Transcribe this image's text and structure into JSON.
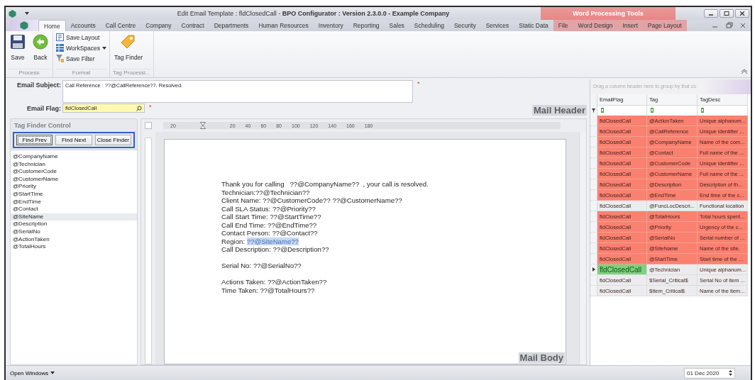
{
  "window": {
    "title": "Edit Email Template : fldClosedCall - **BPO Configurator : Version 2.3.0.0 - Example Company**",
    "context_group": "Word Processing Tools"
  },
  "tabs": [
    {
      "label": "Home",
      "selected": true,
      "context": false
    },
    {
      "label": "Accounts",
      "selected": false,
      "context": false
    },
    {
      "label": "Call Centre",
      "selected": false,
      "context": false
    },
    {
      "label": "Company",
      "selected": false,
      "context": false
    },
    {
      "label": "Contract",
      "selected": false,
      "context": false
    },
    {
      "label": "Departments",
      "selected": false,
      "context": false
    },
    {
      "label": "Human Resources",
      "selected": false,
      "context": false
    },
    {
      "label": "Inventory",
      "selected": false,
      "context": false
    },
    {
      "label": "Reporting",
      "selected": false,
      "context": false
    },
    {
      "label": "Sales",
      "selected": false,
      "context": false
    },
    {
      "label": "Scheduling",
      "selected": false,
      "context": false
    },
    {
      "label": "Security",
      "selected": false,
      "context": false
    },
    {
      "label": "Services",
      "selected": false,
      "context": false
    },
    {
      "label": "Static Data",
      "selected": false,
      "context": false
    },
    {
      "label": "File",
      "selected": false,
      "context": true
    },
    {
      "label": "Word Design",
      "selected": false,
      "context": true
    },
    {
      "label": "Insert",
      "selected": false,
      "context": true
    },
    {
      "label": "Page Layout",
      "selected": false,
      "context": true
    }
  ],
  "ribbon": {
    "groups": [
      {
        "label": "Process",
        "buttons": [
          {
            "label": "Save",
            "kind": "large"
          },
          {
            "label": "Back",
            "kind": "large"
          }
        ]
      },
      {
        "label": "Format",
        "buttons": [
          {
            "label": "Save Layout",
            "kind": "small",
            "dropdown": false
          },
          {
            "label": "WorkSpaces",
            "kind": "small",
            "dropdown": true
          },
          {
            "label": "Save Filter",
            "kind": "small",
            "dropdown": false
          }
        ]
      },
      {
        "label": "Tag Processi...",
        "buttons": [
          {
            "label": "Tag Finder",
            "kind": "large"
          }
        ]
      }
    ]
  },
  "email_subject": {
    "label": "Email Subject:",
    "value": "Call Reference : ??@CallReference??. Resolved.",
    "required_mark": "*"
  },
  "email_flag": {
    "label": "Email Flag:",
    "value": "fldClosedCall",
    "required_mark": "*"
  },
  "mail_header_label": "Mail Header",
  "mail_body_label": "Mail Body",
  "tag_finder": {
    "title": "Tag Finder Control",
    "buttons": [
      {
        "label": "Find Prev",
        "focused": true
      },
      {
        "label": "Find Next",
        "focused": false
      },
      {
        "label": "Close Finder",
        "focused": false
      }
    ],
    "tags": [
      {
        "label": "@CompanyName",
        "selected": false
      },
      {
        "label": "@Technician",
        "selected": false
      },
      {
        "label": "@CustomerCode",
        "selected": false
      },
      {
        "label": "@CustomerName",
        "selected": false
      },
      {
        "label": "@Priority",
        "selected": false
      },
      {
        "label": "@StartTime",
        "selected": false
      },
      {
        "label": "@EndTime",
        "selected": false
      },
      {
        "label": "@Contact",
        "selected": false
      },
      {
        "label": "@SiteName",
        "selected": true
      },
      {
        "label": "@Description",
        "selected": false
      },
      {
        "label": "@SerialNo",
        "selected": false
      },
      {
        "label": "@ActionTaken",
        "selected": false
      },
      {
        "label": "@TotalHours",
        "selected": false
      }
    ]
  },
  "ruler": {
    "labels": [
      "20",
      "20",
      "40",
      "60",
      "80",
      "100",
      "120",
      "140",
      "160",
      "180"
    ]
  },
  "document": {
    "lines": [
      {
        "text": "Thank you for calling   ??@CompanyName??  , your call is resolved.",
        "gap_before": false
      },
      {
        "text": "Technician:??@Technician??",
        "gap_before": false
      },
      {
        "text": "Client Name: ??@CustomerCode?? ??@CustomerName??",
        "gap_before": false
      },
      {
        "text": "Call SLA Status: ??@Priority??",
        "gap_before": false
      },
      {
        "text": "Call Start Time: ??@StartTime??",
        "gap_before": false
      },
      {
        "text": "Call End Time: ??@EndTime??",
        "gap_before": false
      },
      {
        "text": "Contact Person: ??@Contact??",
        "gap_before": false
      },
      {
        "text": "Region: ",
        "selection": "??@SiteName??",
        "gap_before": false
      },
      {
        "text": "Call Description: ??@Description??",
        "gap_before": false
      },
      {
        "text": "Serial No: ??@SerialNo??",
        "gap_before": true
      },
      {
        "text": "Actions Taken: ??@ActionTaken??",
        "gap_before": true
      },
      {
        "text": "Time Taken: ??@TotalHours??",
        "gap_before": false
      }
    ]
  },
  "grid": {
    "group_hint": "Drag a column header here to group by that co",
    "columns": [
      "EmailFlag",
      "Tag",
      "TagDesc"
    ],
    "rows": [
      {
        "cells": [
          "fldClosedCall",
          "@ActionTaken",
          "Unique alphanum..."
        ],
        "highlighted": true,
        "selected": false
      },
      {
        "cells": [
          "fldClosedCall",
          "@CallReference",
          "Unique identifier ..."
        ],
        "highlighted": true,
        "selected": false
      },
      {
        "cells": [
          "fldClosedCall",
          "@CompanyName",
          "Name of the com..."
        ],
        "highlighted": true,
        "selected": false
      },
      {
        "cells": [
          "fldClosedCall",
          "@Contact",
          "Full name of the ..."
        ],
        "highlighted": true,
        "selected": false
      },
      {
        "cells": [
          "fldClosedCall",
          "@CustomerCode",
          "Unique identifier ..."
        ],
        "highlighted": true,
        "selected": false
      },
      {
        "cells": [
          "fldClosedCall",
          "@CustomerName",
          "Full name of the ..."
        ],
        "highlighted": true,
        "selected": false
      },
      {
        "cells": [
          "fldClosedCall",
          "@Description",
          "Description of th..."
        ],
        "highlighted": true,
        "selected": false
      },
      {
        "cells": [
          "fldClosedCall",
          "@EndTime",
          "End time of the c..."
        ],
        "highlighted": true,
        "selected": false
      },
      {
        "cells": [
          "fldClosedCall",
          "@FuncLocDescri...",
          "Functional location"
        ],
        "highlighted": false,
        "selected": false
      },
      {
        "cells": [
          "fldClosedCall",
          "@TotalHours",
          "Total hours spent..."
        ],
        "highlighted": true,
        "selected": false
      },
      {
        "cells": [
          "fldClosedCall",
          "@Priority",
          "Urgency of the c..."
        ],
        "highlighted": true,
        "selected": false
      },
      {
        "cells": [
          "fldClosedCall",
          "@SerialNo",
          "Serial number of ..."
        ],
        "highlighted": true,
        "selected": false
      },
      {
        "cells": [
          "fldClosedCall",
          "@SiteName",
          "Name of the site."
        ],
        "highlighted": true,
        "selected": false
      },
      {
        "cells": [
          "fldClosedCall",
          "@StartTime",
          "Start time of the ..."
        ],
        "highlighted": true,
        "selected": false
      },
      {
        "cells": [
          "fldClosedCall",
          "@Technician",
          "Unique alphanum..."
        ],
        "highlighted": false,
        "selected": true
      },
      {
        "cells": [
          "fldClosedCall",
          "$Serial_Critical$",
          "Serial No of item ..."
        ],
        "highlighted": false,
        "selected": false
      },
      {
        "cells": [
          "fldClosedCall",
          "$Item_Critical$",
          "Name of the item..."
        ],
        "highlighted": false,
        "selected": false
      }
    ]
  },
  "status_bar": {
    "open_windows": "Open Windows",
    "date": "01 Dec 2020"
  }
}
